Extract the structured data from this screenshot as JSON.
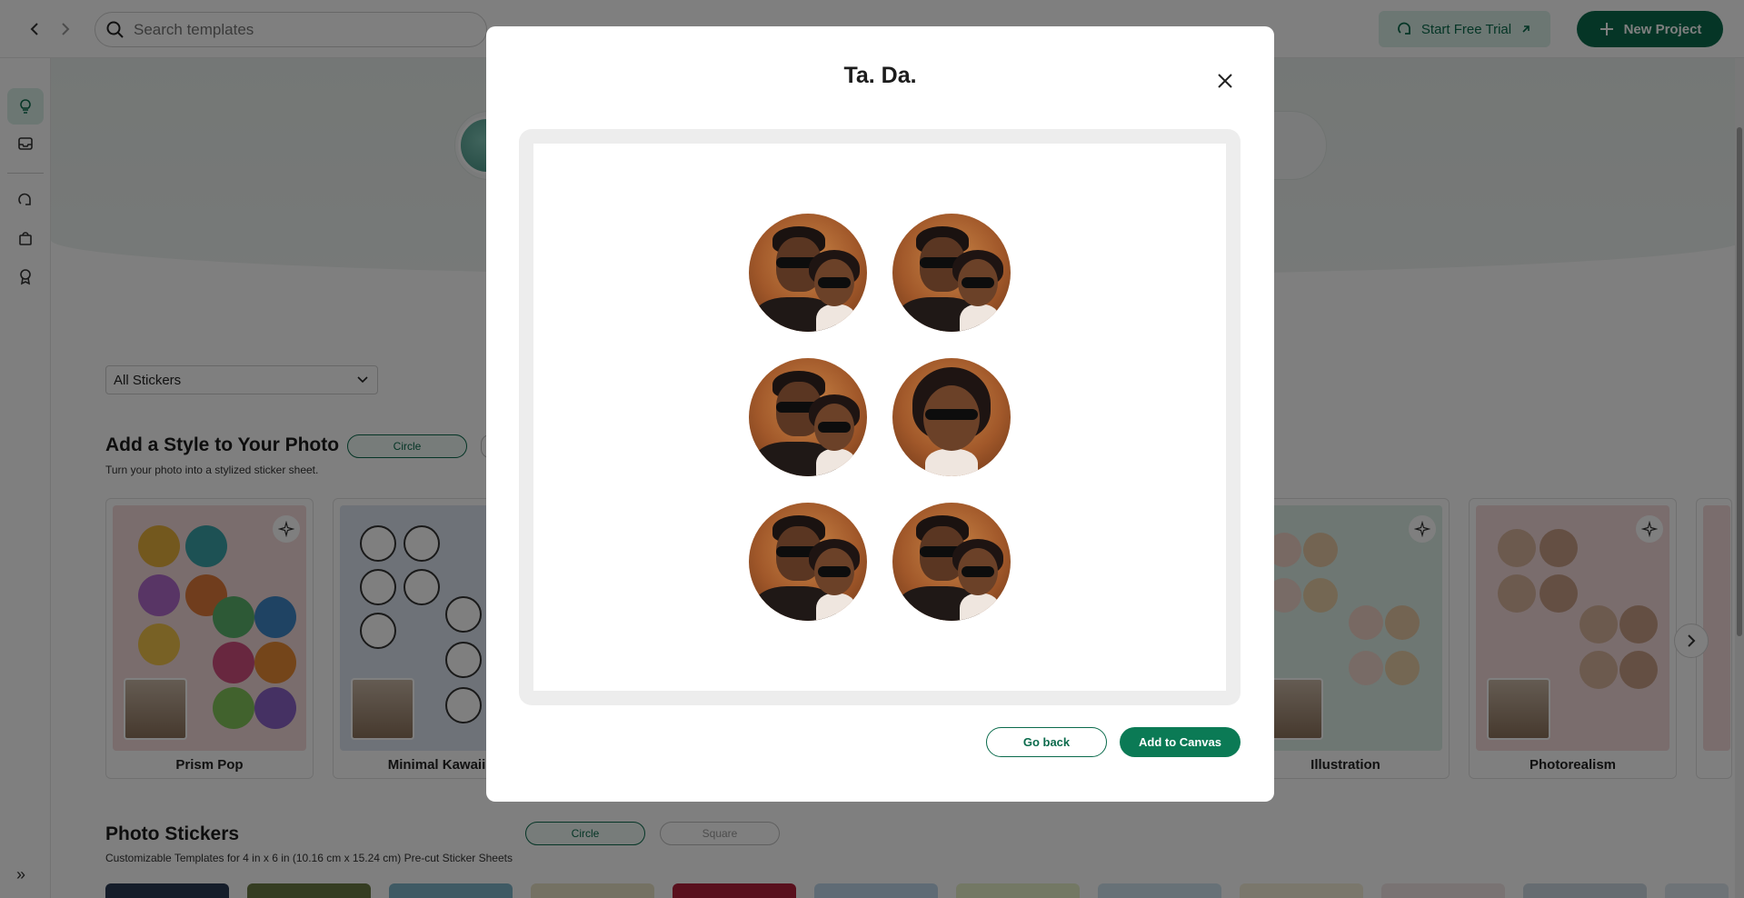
{
  "topbar": {
    "search_placeholder": "Search templates",
    "trial_label": "Start Free Trial",
    "new_project_label": "New Project"
  },
  "rail": {
    "icons": [
      "lightbulb-icon",
      "inbox-icon",
      "cricut-icon",
      "bag-icon",
      "badge-icon"
    ],
    "expand_label": "»"
  },
  "filters": {
    "selected": "All Stickers"
  },
  "style_section": {
    "title": "Add a Style to Your Photo",
    "subtitle": "Turn your photo into a stylized sticker sheet.",
    "chips": [
      "Circle"
    ],
    "cards": [
      {
        "label": "Prism Pop"
      },
      {
        "label": "Minimal Kawaii"
      },
      {
        "label": "Illustration"
      },
      {
        "label": "Photorealism"
      }
    ]
  },
  "photo_section": {
    "title": "Photo Stickers",
    "subtitle": "Customizable Templates for 4 in x 6 in (10.16 cm x 15.24 cm) Pre-cut Sticker Sheets",
    "chips": [
      "Circle",
      "Square"
    ]
  },
  "modal": {
    "title": "Ta. Da.",
    "sticker_count": 6,
    "go_back_label": "Go back",
    "add_label": "Add to Canvas"
  },
  "colors": {
    "brand": "#0b6b4c",
    "brand_light": "#d8efe6",
    "overlay": "rgba(0,0,0,0.5)"
  }
}
